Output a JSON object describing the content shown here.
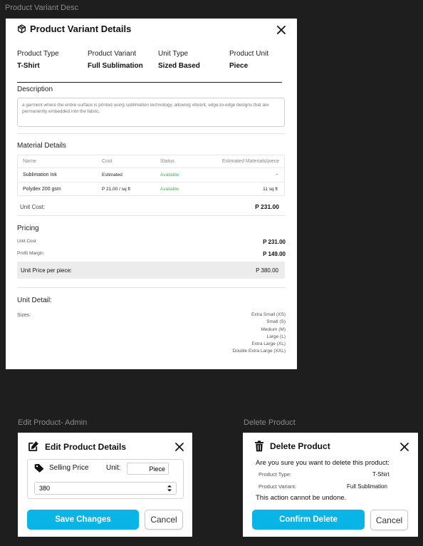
{
  "frames": {
    "main": "Product Variant Desc",
    "edit": "Edit Product- Admin",
    "delete": "Delete Product"
  },
  "variant": {
    "title": "Product Variant Details",
    "info": [
      {
        "label": "Product Type",
        "value": "T-Shirt"
      },
      {
        "label": "Product Variant",
        "value": "Full Sublimation"
      },
      {
        "label": "Unit Type",
        "value": "Sized Based"
      },
      {
        "label": "Product Unit",
        "value": "Piece"
      }
    ],
    "description": {
      "title": "Description",
      "text": "a garment where the entire surface is printed using sublimation technology, allowing vibrant, edge-to-edge designs that are permanently embedded into the fabric."
    },
    "materials": {
      "title": "Material Details",
      "headers": [
        "Name",
        "Cost",
        "Status",
        "Estimated Materials/piece"
      ],
      "rows": [
        {
          "name": "Sublimation Ink",
          "cost": "Estimated",
          "status": "Available",
          "estimate": "-"
        },
        {
          "name": "Polydex 200 gsm",
          "cost": "P 21.00 / sq ft",
          "status": "Available",
          "estimate": "11 sq ft"
        }
      ],
      "unit_cost_label": "Unit Cost:",
      "unit_cost_value": "P 231.00"
    },
    "pricing": {
      "title": "Pricing",
      "unit_cost_label": "Unit Cost",
      "unit_cost_value": "P 231.00",
      "profit_label": "Profit Margin",
      "profit_value": "P 149.00",
      "total_label": "Unit Price per piece:",
      "total_value": "P 380.00"
    },
    "unit_detail": {
      "title": "Unit Detail:",
      "sizes_label": "Sizes:",
      "sizes": [
        "Extra Small (XS)",
        "Small (S)",
        "Medium (M)",
        "Large (L)",
        "Extra Large (XL)",
        "Double Extra Large (XXL)"
      ]
    }
  },
  "edit": {
    "title": "Edit Product Details",
    "selling_label": "Selling Price",
    "unit_label": "Unit:",
    "unit_value": "Piece",
    "price_value": "380",
    "save": "Save Changes",
    "cancel": "Cancel"
  },
  "delete": {
    "title": "Delete Product",
    "question": "Are you sure you want to delete this product:",
    "type_label": "Product Type:",
    "type_value": "T-Shirt",
    "variant_label": "Product Variant:",
    "variant_value": "Full Sublimation",
    "warning": "This action cannot be undone.",
    "confirm": "Confirm Delete",
    "cancel": "Cancel"
  },
  "colors": {
    "primary": "#08b5e6",
    "available": "#4caf50",
    "background": "#1e1e1e"
  }
}
